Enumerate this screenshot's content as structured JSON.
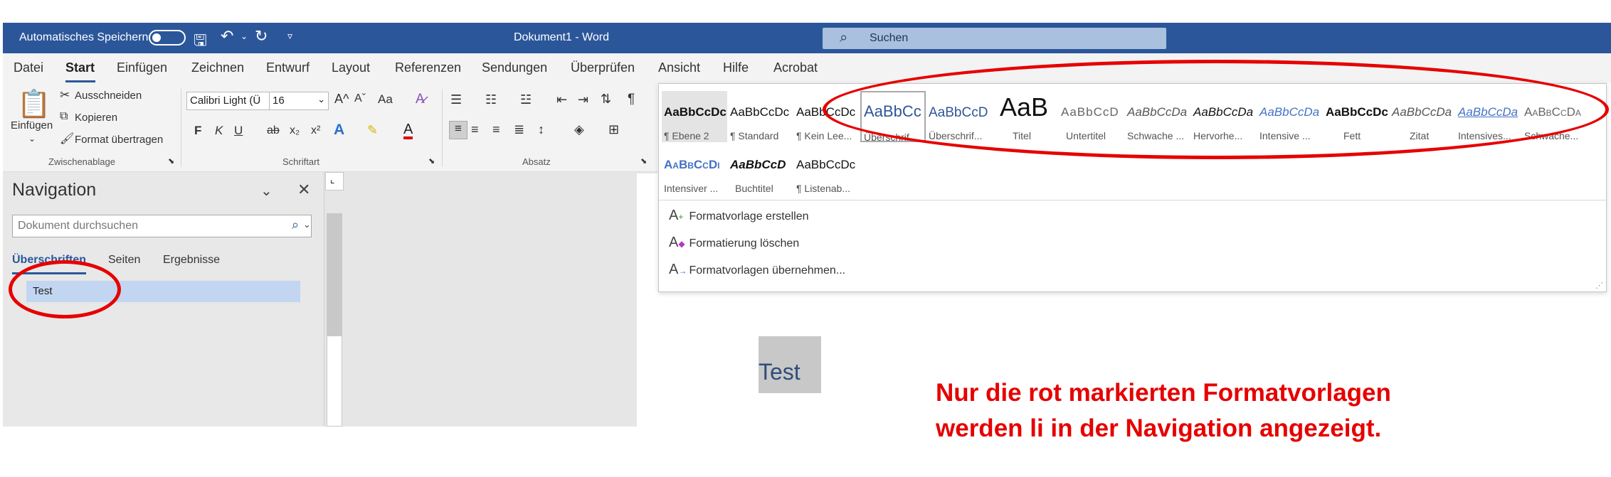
{
  "titlebar": {
    "autosave_label": "Automatisches Speichern",
    "doc_title": "Dokument1  -  Word",
    "search_placeholder": "Suchen"
  },
  "menu": {
    "tabs": [
      "Datei",
      "Start",
      "Einfügen",
      "Zeichnen",
      "Entwurf",
      "Layout",
      "Referenzen",
      "Sendungen",
      "Überprüfen",
      "Ansicht",
      "Hilfe",
      "Acrobat"
    ],
    "active_tab": "Start"
  },
  "ribbon": {
    "clipboard": {
      "paste": "Einfügen",
      "cut": "Ausschneiden",
      "copy": "Kopieren",
      "format_painter": "Format übertragen",
      "group_label": "Zwischenablage"
    },
    "font": {
      "font_name": "Calibri Light (Ü",
      "font_size": "16",
      "group_label": "Schriftart",
      "bold": "F",
      "italic": "K",
      "underline": "U",
      "strike": "ab",
      "sub": "x₂",
      "sup": "x²",
      "grow": "A^",
      "shrink": "Aˇ",
      "case": "Aa",
      "effects": "A",
      "highlight": "✎",
      "font_color": "A"
    },
    "paragraph": {
      "group_label": "Absatz",
      "pilcrow": "¶"
    }
  },
  "gallery": {
    "styles": [
      {
        "preview": "AaBbCcDc",
        "name": "¶ Ebene 2"
      },
      {
        "preview": "AaBbCcDc",
        "name": "¶ Standard"
      },
      {
        "preview": "AaBbCcDc",
        "name": "¶ Kein Lee..."
      },
      {
        "preview": "AaBbCc",
        "name": "Überschrif..."
      },
      {
        "preview": "AaBbCcD",
        "name": "Überschrif..."
      },
      {
        "preview": "AaB",
        "name": "Titel"
      },
      {
        "preview": "AaBbCcD",
        "name": "Untertitel"
      },
      {
        "preview": "AaBbCcDa",
        "name": "Schwache ..."
      },
      {
        "preview": "AaBbCcDa",
        "name": "Hervorhe..."
      },
      {
        "preview": "AaBbCcDa",
        "name": "Intensive ..."
      },
      {
        "preview": "AaBbCcDc",
        "name": "Fett"
      },
      {
        "preview": "AaBbCcDa",
        "name": "Zitat"
      },
      {
        "preview": "AaBbCcDa",
        "name": "Intensives..."
      },
      {
        "preview": "AaBbCcDa",
        "name": "Schwache..."
      },
      {
        "preview": "AaBbCcDı",
        "name": "Intensiver ..."
      },
      {
        "preview": "AaBbCcD",
        "name": "Buchtitel"
      },
      {
        "preview": "AaBbCcDc",
        "name": "¶ Listenab..."
      }
    ],
    "commands": [
      "Formatvorlage erstellen",
      "Formatierung löschen",
      "Formatvorlagen übernehmen..."
    ]
  },
  "navigation": {
    "title": "Navigation",
    "search_placeholder": "Dokument durchsuchen",
    "tabs": [
      "Überschriften",
      "Seiten",
      "Ergebnisse"
    ],
    "headings": [
      "Test"
    ]
  },
  "document": {
    "heading_text": "Test"
  },
  "annotation": {
    "line1": "Nur die rot markierten Formatvorlagen",
    "line2": "werden li in der Navigation angezeigt.",
    "color": "#e60000"
  },
  "colors": {
    "titlebar": "#2b579a",
    "highlight_blue": "#c2d6f1"
  }
}
